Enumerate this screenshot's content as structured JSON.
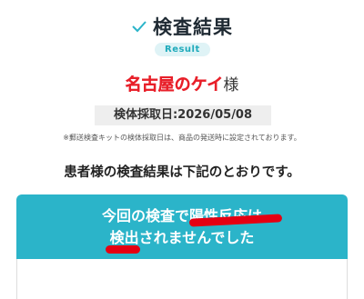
{
  "header": {
    "title": "検査結果",
    "badge": "Result",
    "check_icon": "check-icon"
  },
  "patient": {
    "name": "名古屋のケイ",
    "suffix": "様"
  },
  "sample_date": "検体採取日:2026/05/08",
  "note": "※郵送検査キットの検体採取日は、商品の発送時に設定されております。",
  "intro": "患者様の検査結果は下記のとおりです。",
  "result": {
    "line1": "今回の検査で陽性反応は",
    "line2": "検出されませんでした"
  },
  "colors": {
    "accent": "#2bb4c9",
    "name_red": "#e8202a",
    "pill_bg": "#dff3f6"
  }
}
